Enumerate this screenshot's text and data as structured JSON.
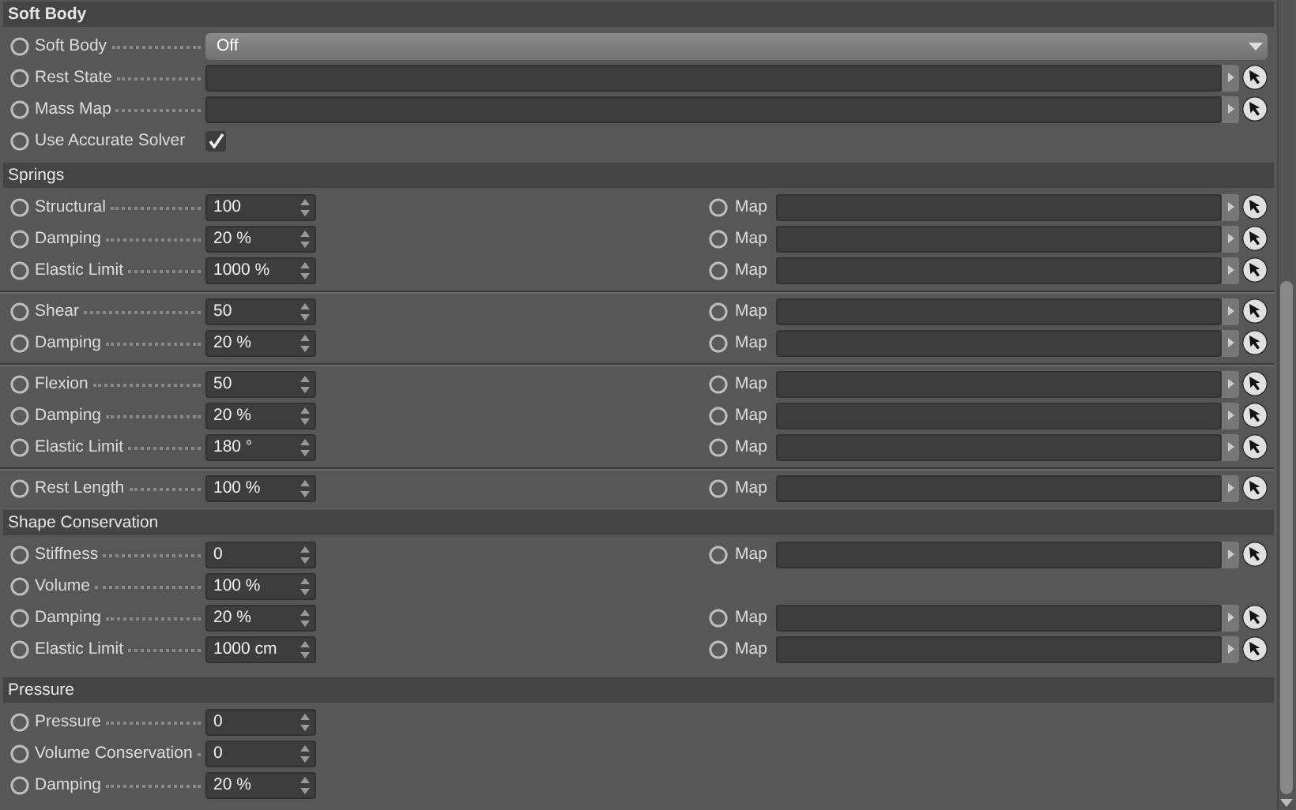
{
  "sections": [
    {
      "title": "Soft Body",
      "groups": [
        [
          {
            "kind": "dropdown",
            "label": "Soft Body",
            "value": "Off"
          },
          {
            "kind": "link",
            "label": "Rest State"
          },
          {
            "kind": "link",
            "label": "Mass Map"
          },
          {
            "kind": "checkbox",
            "label": "Use Accurate Solver",
            "checked": true
          }
        ]
      ]
    },
    {
      "title": "Springs",
      "groups": [
        [
          {
            "kind": "number",
            "label": "Structural",
            "value": "100",
            "map": "Map"
          },
          {
            "kind": "number",
            "label": "Damping",
            "value": "20 %",
            "map": "Map"
          },
          {
            "kind": "number",
            "label": "Elastic Limit",
            "value": "1000 %",
            "map": "Map"
          }
        ],
        [
          {
            "kind": "number",
            "label": "Shear",
            "value": "50",
            "map": "Map"
          },
          {
            "kind": "number",
            "label": "Damping",
            "value": "20 %",
            "map": "Map"
          }
        ],
        [
          {
            "kind": "number",
            "label": "Flexion",
            "value": "50",
            "map": "Map"
          },
          {
            "kind": "number",
            "label": "Damping",
            "value": "20 %",
            "map": "Map"
          },
          {
            "kind": "number",
            "label": "Elastic Limit",
            "value": "180 °",
            "map": "Map"
          }
        ],
        [
          {
            "kind": "number",
            "label": "Rest Length",
            "value": "100 %",
            "map": "Map"
          }
        ]
      ]
    },
    {
      "title": "Shape Conservation",
      "groups": [
        [
          {
            "kind": "number",
            "label": "Stiffness",
            "value": "0",
            "map": "Map"
          },
          {
            "kind": "number",
            "label": "Volume",
            "value": "100 %"
          },
          {
            "kind": "number",
            "label": "Damping",
            "value": "20 %",
            "map": "Map"
          },
          {
            "kind": "number",
            "label": "Elastic Limit",
            "value": "1000 cm",
            "map": "Map"
          }
        ]
      ]
    },
    {
      "title": "Pressure",
      "groups": [
        [
          {
            "kind": "number",
            "label": "Pressure",
            "value": "0"
          },
          {
            "kind": "number",
            "label": "Volume Conservation",
            "value": "0"
          },
          {
            "kind": "number",
            "label": "Damping",
            "value": "20 %"
          }
        ]
      ]
    }
  ]
}
